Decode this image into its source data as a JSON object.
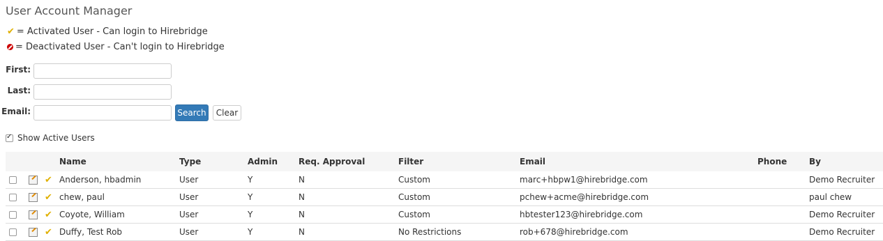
{
  "page": {
    "title": "User Account Manager"
  },
  "legend": {
    "activated": "= Activated User - Can login to Hirebridge",
    "deactivated": "= Deactivated User - Can't login to Hirebridge"
  },
  "search": {
    "first_label": "First:",
    "last_label": "Last:",
    "email_label": "Email:",
    "first_value": "",
    "last_value": "",
    "email_value": "",
    "search_button": "Search",
    "clear_button": "Clear"
  },
  "filter": {
    "show_active_label": "Show Active Users",
    "show_active_checked": true
  },
  "table": {
    "headers": [
      "Name",
      "Type",
      "Admin",
      "Req. Approval",
      "Filter",
      "Email",
      "Phone",
      "By"
    ],
    "rows": [
      {
        "name": "Anderson, hbadmin",
        "type": "User",
        "admin": "Y",
        "req_approval": "N",
        "filter": "Custom",
        "email": "marc+hbpw1@hirebridge.com",
        "phone": "",
        "by": "Demo Recruiter"
      },
      {
        "name": "chew, paul",
        "type": "User",
        "admin": "Y",
        "req_approval": "N",
        "filter": "Custom",
        "email": "pchew+acme@hirebridge.com",
        "phone": "",
        "by": "paul chew"
      },
      {
        "name": "Coyote, William",
        "type": "User",
        "admin": "Y",
        "req_approval": "N",
        "filter": "Custom",
        "email": "hbtester123@hirebridge.com",
        "phone": "",
        "by": "Demo Recruiter"
      },
      {
        "name": "Duffy, Test Rob",
        "type": "User",
        "admin": "Y",
        "req_approval": "N",
        "filter": "No Restrictions",
        "email": "rob+678@hirebridge.com",
        "phone": "",
        "by": "Demo Recruiter"
      }
    ]
  },
  "colors": {
    "primary_button": "#337ab7",
    "activated_check": "#e0b000",
    "deactivated_icon": "#cc0000"
  },
  "icons": {
    "activated": "checkmark-icon",
    "deactivated": "deactivated-icon",
    "edit": "edit-icon"
  }
}
